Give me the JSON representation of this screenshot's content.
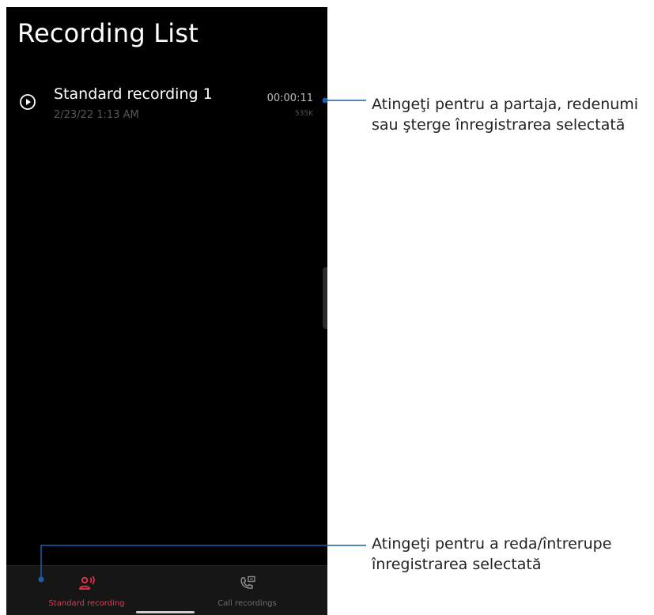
{
  "header": {
    "title": "Recording List"
  },
  "recordings": [
    {
      "name": "Standard recording 1",
      "date": "2/23/22 1:13 AM",
      "duration": "00:00:11",
      "size": "535K"
    }
  ],
  "bottom_nav": {
    "tabs": [
      {
        "label": "Standard recording",
        "icon": "voice-recording-icon",
        "active": true
      },
      {
        "label": "Call recordings",
        "icon": "phone-recording-icon",
        "active": false
      }
    ]
  },
  "callouts": {
    "top": {
      "line1": "Atingeţi pentru a partaja, redenumi",
      "line2": "sau şterge înregistrarea selectată"
    },
    "bottom": {
      "line1": "Atingeţi pentru a reda/întrerupe",
      "line2": "înregistrarea selectată"
    }
  },
  "colors": {
    "accent": "#e8344e",
    "callout_line": "#1a5fa8",
    "background": "#000000"
  }
}
